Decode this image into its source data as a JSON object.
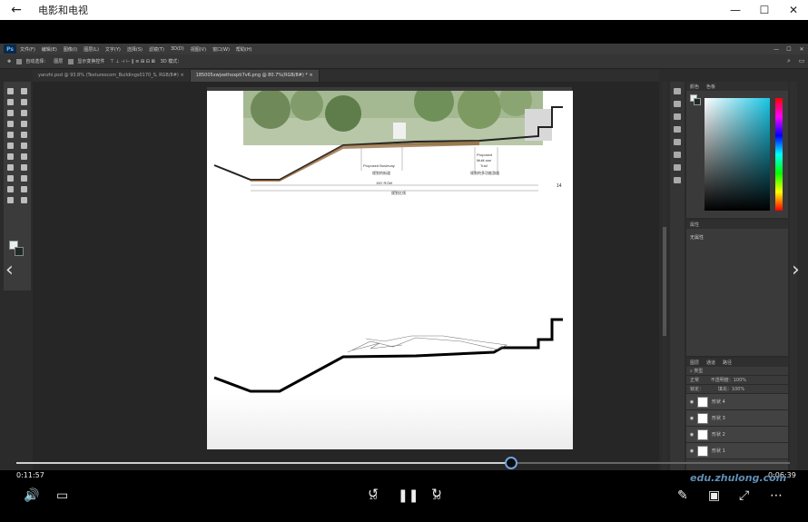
{
  "window": {
    "title": "电影和电视",
    "back_icon": "←",
    "minimize": "—",
    "maximize": "☐",
    "close": "✕"
  },
  "photoshop": {
    "logo": "Ps",
    "menu": [
      "文件(F)",
      "编辑(E)",
      "图像(I)",
      "图层(L)",
      "文字(Y)",
      "选择(S)",
      "滤镜(T)",
      "3D(D)",
      "视图(V)",
      "窗口(W)",
      "帮助(H)"
    ],
    "options": {
      "auto_select_label": "自动选择：",
      "auto_select_value": "图层",
      "show_transform_label": "显示变换控件",
      "mode3d": "3D 模式："
    },
    "tabs": [
      {
        "label": "yanzhi.psd @ 93.8% (Texturescom_Buildings0170_S, RGB/8#) ×",
        "active": false
      },
      {
        "label": "185005xwjxethoxpti7v6.png @ 80.7%(RGB/8#) * ×",
        "active": true
      }
    ],
    "doc_labels": {
      "walkway_en": "Proposed Boulevay",
      "walkway_cn": "规划的街道",
      "trail_en1": "Proposed",
      "trail_en2": "Multi-use",
      "trail_en3": "Trail",
      "trail_cn": "规划的多功能游道",
      "row_en": "150' ROW",
      "row_cn": "规划红线",
      "page_number": "14"
    },
    "panels": {
      "color_tabs": [
        "颜色",
        "色板"
      ],
      "props_tab": "属性",
      "props_value": "无属性",
      "layers_tabs": [
        "图层",
        "通道",
        "路径"
      ],
      "layer_filter": "类型",
      "blend_mode": "正常",
      "opacity_label": "不透明度：",
      "opacity_value": "100%",
      "lock_label": "锁定：",
      "fill_label": "填充：",
      "fill_value": "100%",
      "layers": [
        "形状 4",
        "形状 3",
        "形状 2",
        "形状 1"
      ]
    }
  },
  "player": {
    "prev_arrow": "‹",
    "next_arrow": "›",
    "time_elapsed": "0:11:57",
    "time_remaining": "0:06:39",
    "progress": 0.64,
    "watermark": "edu.zhulong.com",
    "skip_back_seconds": "10",
    "skip_forward_seconds": "30",
    "volume_icon": "🔊",
    "subtitle_icon": "▭",
    "pause_icon": "❚❚",
    "pen_icon": "✎",
    "miniview_icon": "▣",
    "expand_icon": "⤢",
    "more_icon": "⋯"
  }
}
